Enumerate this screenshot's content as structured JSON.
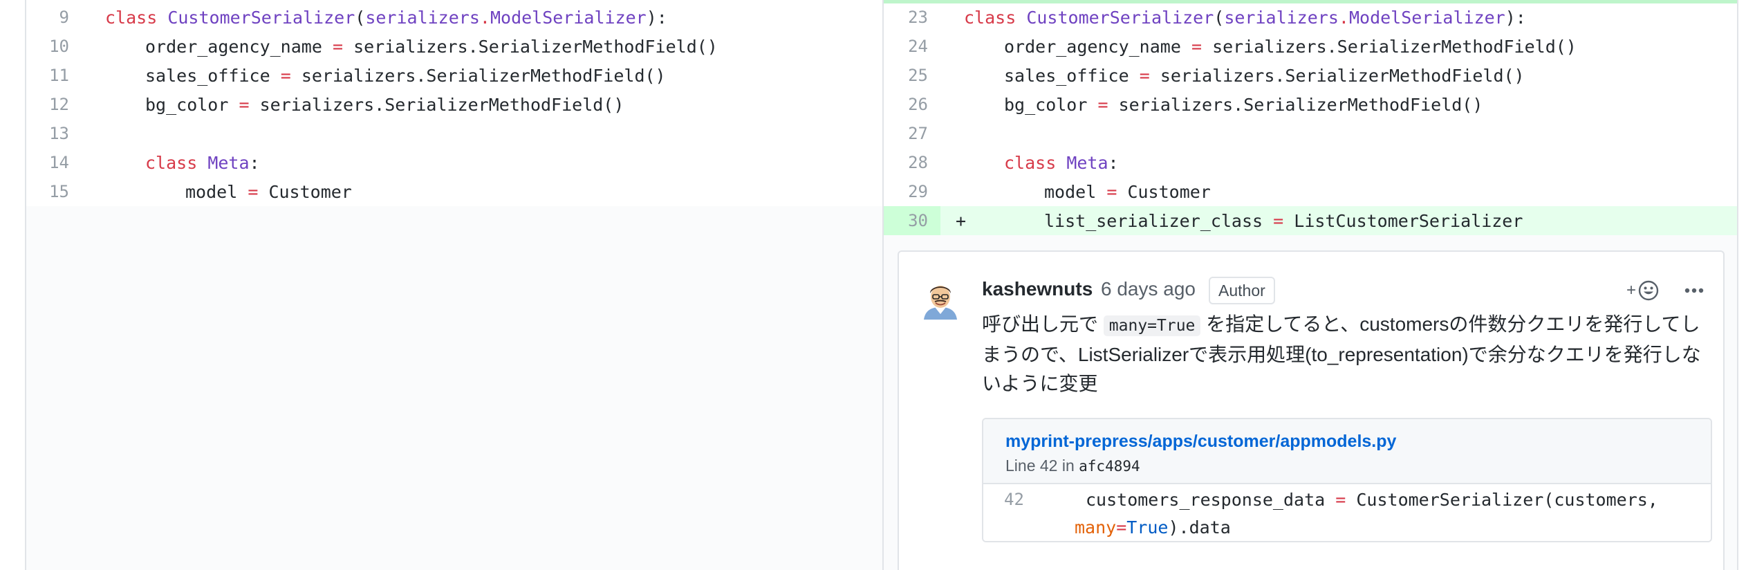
{
  "left_pane": {
    "lines": [
      {
        "num": "9"
      },
      {
        "num": "10"
      },
      {
        "num": "11"
      },
      {
        "num": "12"
      },
      {
        "num": "13"
      },
      {
        "num": "14"
      },
      {
        "num": "15"
      }
    ]
  },
  "right_pane": {
    "lines": [
      {
        "num": "23"
      },
      {
        "num": "24"
      },
      {
        "num": "25"
      },
      {
        "num": "26"
      },
      {
        "num": "27"
      },
      {
        "num": "28"
      },
      {
        "num": "29"
      },
      {
        "num": "30",
        "marker": "+"
      }
    ]
  },
  "code": {
    "class_kw": "class",
    "class_name": "CustomerSerializer",
    "open_paren": "(",
    "base_module": "serializers",
    "dot": ".",
    "base_class": "ModelSerializer",
    "close": "):",
    "field1_name": "order_agency_name",
    "field2_name": "sales_office",
    "field3_name": "bg_color",
    "eq": "=",
    "field_value": "serializers.SerializerMethodField()",
    "meta_kw": "class",
    "meta_name": "Meta",
    "colon": ":",
    "model_attr": "model",
    "model_value": "Customer",
    "list_attr": "list_serializer_class",
    "list_value": "ListCustomerSerializer"
  },
  "comment": {
    "author": "kashewnuts",
    "timestamp": "6 days ago",
    "badge": "Author",
    "reaction_plus": "+",
    "body_part1": "呼び出し元で ",
    "body_code": "many=True",
    "body_part2": " を指定してると、customersの件数分クエリを発行してしまうので、ListSerializerで表示用処理(to_representation)で余分なクエリを発行しないように変更",
    "reference": {
      "path": "myprint-prepress/apps/customer/appmodels.py",
      "line_label": "Line 42 in",
      "sha": "afc4894",
      "line_num": "42",
      "code_part1": "customers_response_data",
      "code_eq": "=",
      "code_part2": "CustomerSerializer(customers,",
      "code_kwarg": "many",
      "code_eq2": "=",
      "code_true": "True",
      "code_tail": ").data"
    }
  },
  "colors": {
    "keyword": "#d73a49",
    "class_name": "#6f42c1",
    "added_bg": "#e6ffed",
    "added_gutter": "#cdffd8",
    "link": "#0366d6"
  },
  "icons": {
    "reaction": "smiley-icon",
    "more": "kebab-horizontal-icon"
  }
}
